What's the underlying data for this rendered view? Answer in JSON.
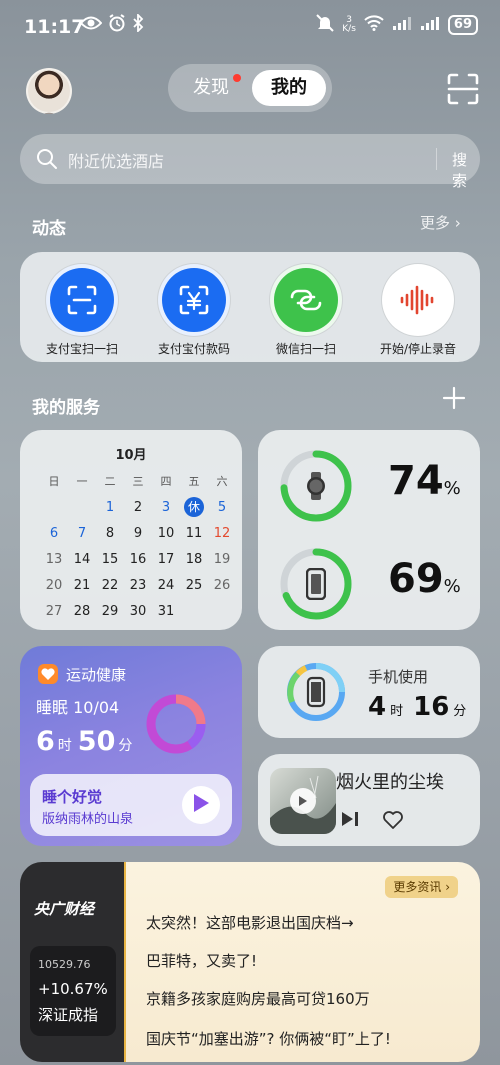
{
  "status_bar": {
    "time": "11:17",
    "net_speed_top": "3",
    "net_speed_unit": "K/s",
    "battery": "69"
  },
  "tabs": {
    "discover": "发现",
    "mine": "我的"
  },
  "search": {
    "placeholder": "附近优选酒店",
    "button": "搜索"
  },
  "dynamic": {
    "title": "动态",
    "more": "更多",
    "items": [
      {
        "label": "支付宝扫一扫",
        "icon": "alipay-scan-icon",
        "color": "#1b6cf2"
      },
      {
        "label": "支付宝付款码",
        "icon": "alipay-pay-code-icon",
        "color": "#1b6cf2"
      },
      {
        "label": "微信扫一扫",
        "icon": "wechat-scan-icon",
        "color": "#3ec24b"
      },
      {
        "label": "开始/停止录音",
        "icon": "recorder-icon",
        "color": "#ffffff"
      }
    ]
  },
  "services": {
    "title": "我的服务",
    "calendar": {
      "month": "10月",
      "weekdays": [
        "日",
        "一",
        "二",
        "三",
        "四",
        "五",
        "六"
      ],
      "weeks": [
        [
          "",
          "",
          "1",
          "2",
          "3",
          "休",
          "5"
        ],
        [
          "6",
          "7",
          "8",
          "9",
          "10",
          "11",
          "12"
        ],
        [
          "13",
          "14",
          "15",
          "16",
          "17",
          "18",
          "19"
        ],
        [
          "20",
          "21",
          "22",
          "23",
          "24",
          "25",
          "26"
        ],
        [
          "27",
          "28",
          "29",
          "30",
          "31",
          "",
          ""
        ]
      ]
    },
    "devices": [
      {
        "name": "watch",
        "percent": "74",
        "unit": "%",
        "level": 0.74
      },
      {
        "name": "phone",
        "percent": "69",
        "unit": "%",
        "level": 0.69
      }
    ],
    "health": {
      "title": "运动健康",
      "sleep_label": "睡眠 10/04",
      "hours": "6",
      "hours_unit": "时",
      "minutes": "50",
      "minutes_unit": "分",
      "promo_title": "睡个好觉",
      "promo_sub": "版纳雨林的山泉"
    },
    "phone_usage": {
      "title": "手机使用",
      "hours": "4",
      "hours_unit": "时",
      "minutes": "16",
      "minutes_unit": "分"
    },
    "music": {
      "song": "烟火里的尘埃"
    }
  },
  "news": {
    "brand": "央广财经",
    "more": "更多资讯",
    "index_value": "10529.76",
    "index_change": "+10.67%",
    "index_name": "深证成指",
    "items": [
      "太突然！这部电影退出国庆档→",
      "巴菲特，又卖了!",
      "京籍多孩家庭购房最高可贷160万",
      "国庆节“加塞出游”? 你俩被“盯”上了!"
    ]
  }
}
